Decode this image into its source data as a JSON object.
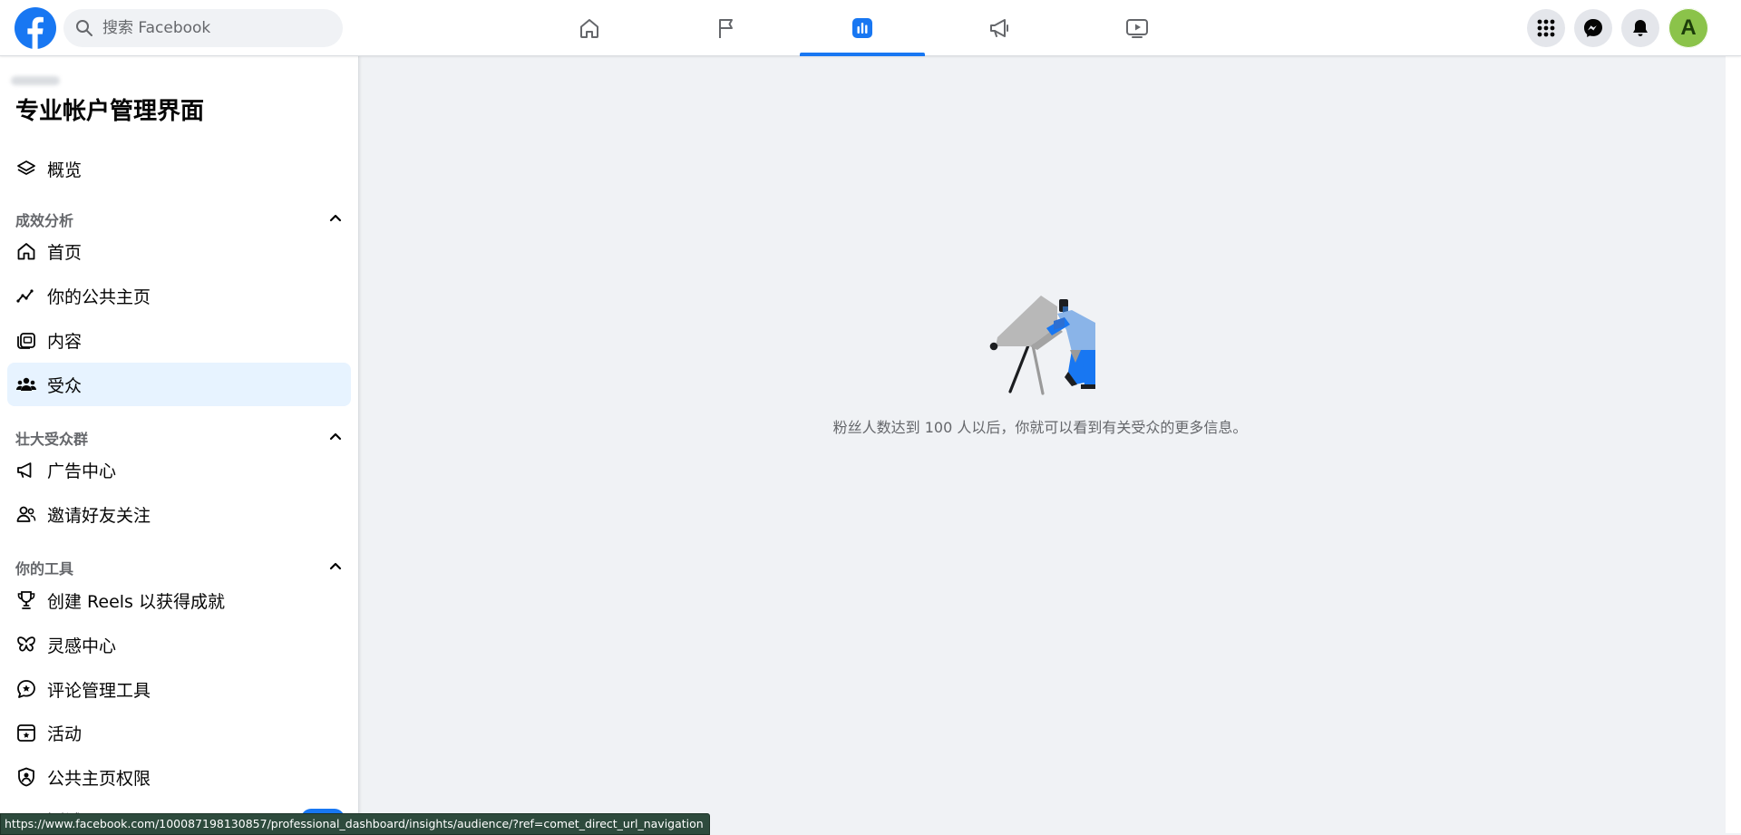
{
  "search": {
    "placeholder": "搜索 Facebook"
  },
  "nav": {
    "tabs": [
      {
        "icon": "home-icon"
      },
      {
        "icon": "flag-icon"
      },
      {
        "icon": "insights-icon",
        "active": true
      },
      {
        "icon": "megaphone-icon"
      },
      {
        "icon": "video-icon"
      }
    ]
  },
  "header_right": {
    "menu_icon": "grid-menu-icon",
    "messenger_icon": "messenger-icon",
    "notifications_icon": "bell-icon",
    "avatar_letter": "A"
  },
  "sidebar": {
    "title": "专业帐户管理界面",
    "overview": "概览",
    "sections": [
      {
        "heading": "成效分析",
        "items": [
          {
            "label": "首页",
            "icon": "home-outline-icon"
          },
          {
            "label": "你的公共主页",
            "icon": "trend-line-icon"
          },
          {
            "label": "内容",
            "icon": "content-icon"
          },
          {
            "label": "受众",
            "icon": "audience-icon",
            "active": true
          }
        ]
      },
      {
        "heading": "壮大受众群",
        "items": [
          {
            "label": "广告中心",
            "icon": "megaphone-outline-icon"
          },
          {
            "label": "邀请好友关注",
            "icon": "invite-friends-icon"
          }
        ]
      },
      {
        "heading": "你的工具",
        "items": [
          {
            "label": "创建 Reels 以获得成就",
            "icon": "trophy-icon"
          },
          {
            "label": "灵感中心",
            "icon": "butterfly-icon"
          },
          {
            "label": "评论管理工具",
            "icon": "comment-star-icon"
          },
          {
            "label": "活动",
            "icon": "calendar-star-icon"
          },
          {
            "label": "公共主页权限",
            "icon": "shield-user-icon"
          }
        ]
      }
    ],
    "partial_item": "测试"
  },
  "main": {
    "empty_message": "粉丝人数达到 100 人以后，你就可以看到有关受众的更多信息。"
  },
  "status_bar": {
    "url": "https://www.facebook.com/100087198130857/professional_dashboard/insights/audience/?ref=comet_direct_url_navigation"
  },
  "colors": {
    "brand": "#1877f2",
    "active_item_bg": "#e7f3ff",
    "page_bg": "#f0f2f5"
  }
}
